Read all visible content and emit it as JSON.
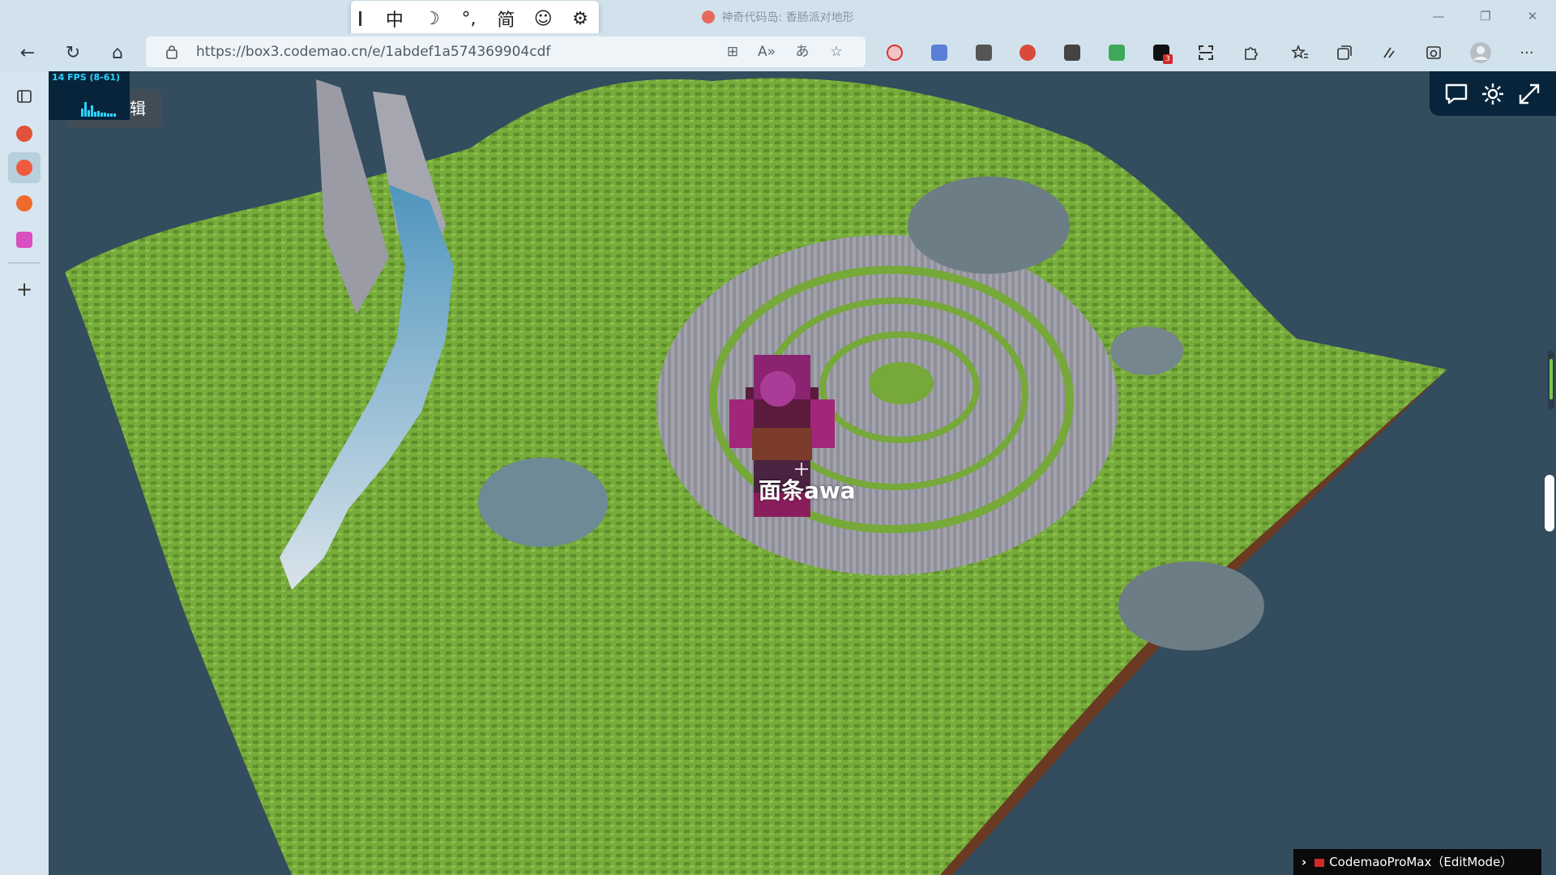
{
  "window": {
    "title": "神奇代码岛: 香肠派对地形",
    "controls": {
      "minimize": "—",
      "maximize": "❐",
      "close": "✕"
    }
  },
  "ime": {
    "buttons": [
      "中",
      "☽",
      "°,",
      "简",
      "☺",
      "⚙"
    ]
  },
  "toolbar": {
    "back": "←",
    "reload": "↻",
    "home": "⌂",
    "url": "https://box3.codemao.cn/e/1abdef1a574369904cdf",
    "omni_icons": [
      "⊞",
      "A»",
      "あ",
      "☆"
    ],
    "ext_badge": "3",
    "more": "···"
  },
  "viewport": {
    "fps": "14 FPS (8-61)",
    "edit_label": "辑",
    "player_name": "面条awa",
    "console_label": "CodemaoProMax（EditMode）"
  },
  "colors": {
    "accent": "#2ad5ff",
    "sky": "#334c5e",
    "grass": "#74a83a",
    "stone": "#8e8f98",
    "water": "#5e97b5"
  }
}
